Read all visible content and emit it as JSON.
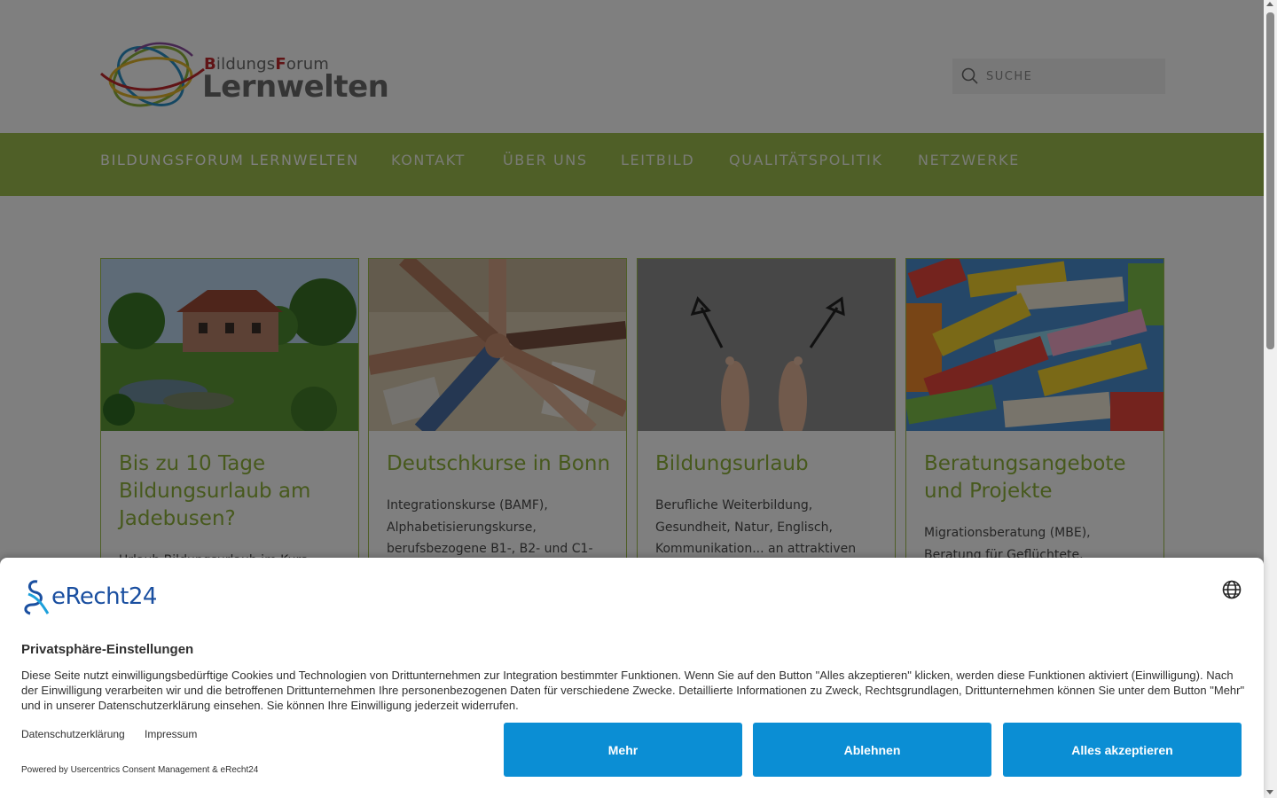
{
  "brand": {
    "logo_small_text_1": "B",
    "logo_small_text_2": "ildungs",
    "logo_small_text_3": "F",
    "logo_small_text_4": "orum",
    "logo_main_text": "Lernwelten"
  },
  "search": {
    "placeholder": "SUCHE"
  },
  "nav": {
    "items": [
      {
        "label": "BILDUNGSFORUM LERNWELTEN"
      },
      {
        "label": "KONTAKT"
      },
      {
        "label": "ÜBER UNS"
      },
      {
        "label": "LEITBILD"
      },
      {
        "label": "QUALITÄTSPOLITIK"
      },
      {
        "label": "NETZWERKE"
      }
    ]
  },
  "cards": [
    {
      "title": "Bis zu 10 Tage Bildungsurlaub am Jadebusen?",
      "text": "Urlaub Bildungsurlaub im Kurs",
      "image": "country-house-garden"
    },
    {
      "title": "Deutschkurse in Bonn",
      "text": "Integrationskurse (BAMF), Alphabetisierungskurse, berufsbezogene B1-, B2- und C1-",
      "image": "stacked-hands"
    },
    {
      "title": "Bildungsurlaub",
      "text": "Berufliche Weiterbildung, Gesundheit, Natur, Englisch, Kommunikation... an attraktiven",
      "image": "feet-with-arrows"
    },
    {
      "title": "Beratungsangebote und Projekte",
      "text": "Migrationsberatung (MBE), Beratung für Geflüchtete,",
      "image": "welcome-words-collage"
    }
  ],
  "consent": {
    "brand": "eRecht24",
    "title": "Privatsphäre-Einstellungen",
    "description": "Diese Seite nutzt einwilligungsbedürftige Cookies und Technologien von Drittunternehmen zur Integration bestimmter Funktionen. Wenn Sie auf den Button \"Alles akzeptieren\" klicken, werden diese Funktionen aktiviert (Einwilligung). Nach der Einwilligung verarbeiten wir und die betroffenen Drittunternehmen Ihre personenbezogenen Daten für verschiedene Zwecke. Detaillierte Informationen zu Zweck, Rechtsgrundlagen, Drittunternehmen können Sie unter dem Button \"Mehr\" und in unserer Datenschutzerklärung einsehen. Sie können Ihre Einwilligung jederzeit widerrufen.",
    "link_privacy": "Datenschutzerklärung",
    "link_imprint": "Impressum",
    "powered_by": "Powered by Usercentrics Consent Management & eRecht24",
    "btn_more": "Mehr",
    "btn_decline": "Ablehnen",
    "btn_accept_all": "Alles akzeptieren"
  },
  "colors": {
    "nav_green": "#9fbf4f",
    "title_green": "#8fb33a",
    "button_blue": "#0b8ed4"
  }
}
